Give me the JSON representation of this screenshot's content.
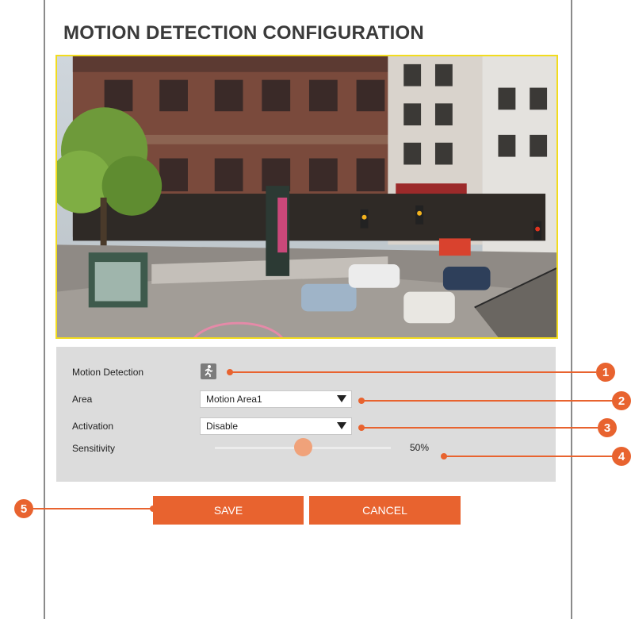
{
  "page": {
    "title": "MOTION DETECTION CONFIGURATION"
  },
  "video": {
    "description_icon": "camera-feed-street-scene"
  },
  "settings": {
    "motion_detection": {
      "label": "Motion Detection",
      "icon": "motion-runner-icon"
    },
    "area": {
      "label": "Area",
      "value": "Motion Area1"
    },
    "activation": {
      "label": "Activation",
      "value": "Disable"
    },
    "sensitivity": {
      "label": "Sensitivity",
      "value_text": "50%",
      "value": 0.5
    }
  },
  "buttons": {
    "save": "SAVE",
    "cancel": "CANCEL"
  },
  "callouts": [
    "1",
    "2",
    "3",
    "4",
    "5"
  ],
  "colors": {
    "accent": "#e8632f",
    "panel_bg": "#dcdcdc",
    "video_border": "#f2dc1e"
  }
}
